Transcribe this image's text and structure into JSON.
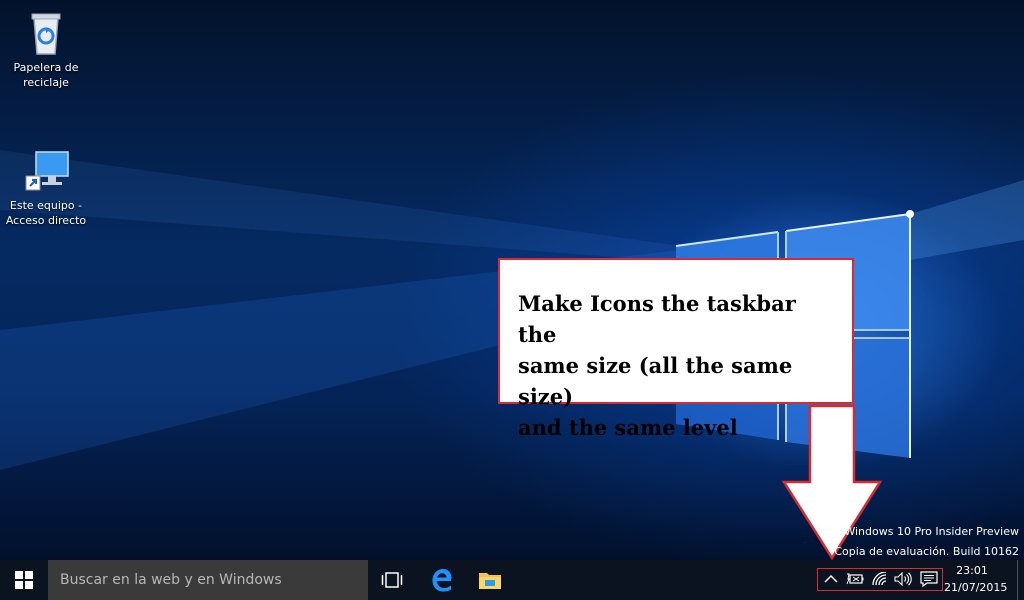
{
  "desktop": {
    "icons": [
      {
        "label_line1": "Papelera de",
        "label_line2": "reciclaje",
        "icon": "recycle-bin-icon"
      },
      {
        "label_line1": "Este equipo -",
        "label_line2": "Acceso directo",
        "icon": "computer-icon"
      }
    ]
  },
  "callout": {
    "line1": "Make Icons the taskbar the",
    "line2": "same size (all the same size)",
    "line3": "and the same level"
  },
  "watermark": {
    "line1": "Windows 10 Pro Insider Preview",
    "line2": "Copia de evaluación. Build 10162"
  },
  "taskbar": {
    "search_placeholder": "Buscar en la web y en Windows",
    "pinned": [
      "task-view-icon",
      "edge-icon",
      "file-explorer-icon"
    ],
    "tray": [
      "chevron-up-icon",
      "battery-icon",
      "wifi-icon",
      "volume-icon",
      "action-center-icon"
    ],
    "clock": {
      "time": "23:01",
      "date": "21/07/2015"
    }
  },
  "colors": {
    "accent_red": "#d82b30",
    "taskbar": "#0c1320",
    "search_box": "#3a3a3a",
    "edge_blue": "#1e90ff"
  }
}
